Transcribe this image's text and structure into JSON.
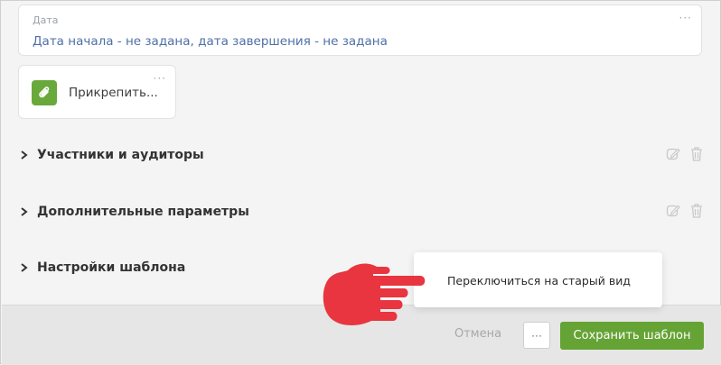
{
  "date_field": {
    "caption": "Дата",
    "value": "Дата начала - не задана, дата завершения - не задана"
  },
  "attach": {
    "label": "Прикрепить..."
  },
  "sections": [
    {
      "title": "Участники и аудиторы"
    },
    {
      "title": "Дополнительные параметры"
    },
    {
      "title": "Настройки шаблона"
    }
  ],
  "footer": {
    "cancel_label": "Отмена",
    "more_label": "···",
    "save_label": "Сохранить шаблон"
  },
  "tooltip": {
    "text": "Переключиться на старый вид"
  },
  "colors": {
    "accent_green": "#66a335",
    "link_blue": "#4e6fa8",
    "hand_red": "#e8353f"
  },
  "icons": [
    "more-dots-icon",
    "paperclip-icon",
    "chevron-right-icon",
    "edit-icon",
    "trash-icon",
    "pointing-hand-icon"
  ]
}
